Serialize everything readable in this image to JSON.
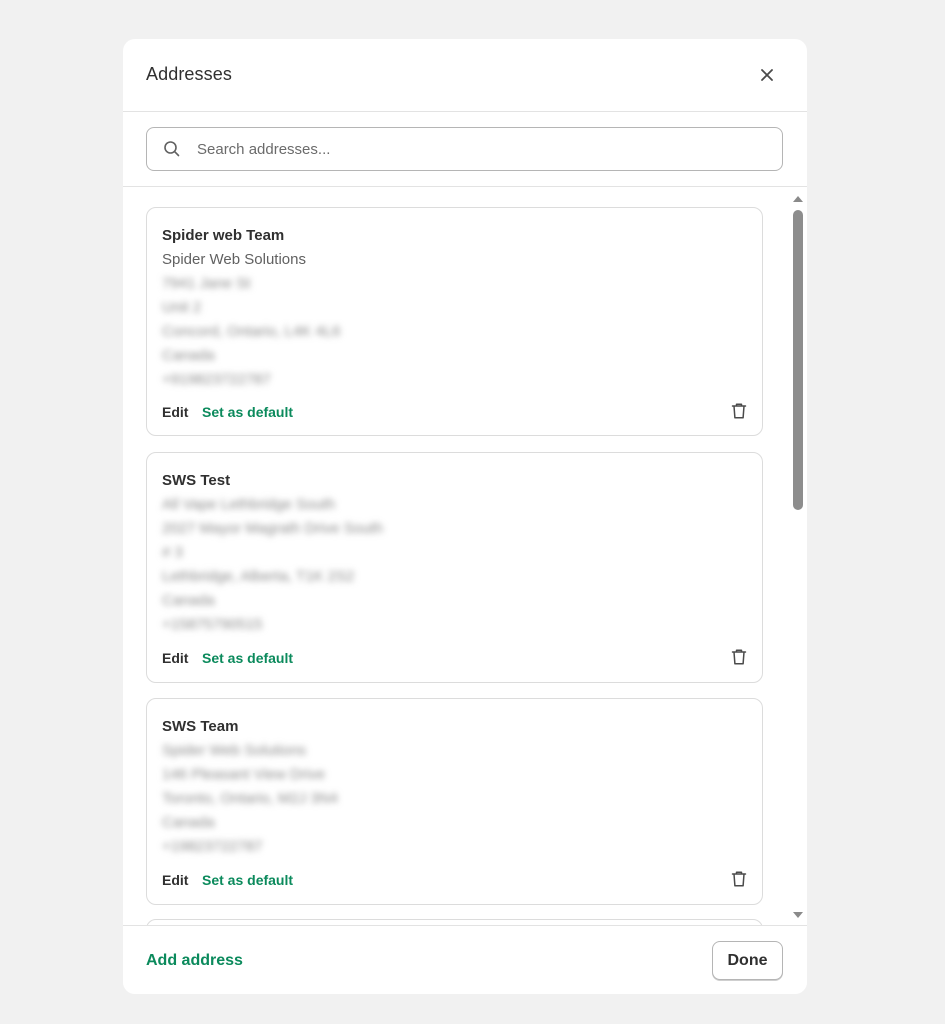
{
  "modal": {
    "title": "Addresses",
    "search": {
      "placeholder": "Search addresses..."
    },
    "addresses": [
      {
        "name": "Spider web Team",
        "company": "Spider Web Solutions",
        "lines": [
          "7941 Jane St",
          "Unit 2",
          "Concord, Ontario, L4K 4L6",
          "Canada",
          "+919823722787"
        ],
        "edit_label": "Edit",
        "default_label": "Set as default"
      },
      {
        "name": "SWS Test",
        "lines": [
          "All Vape Lethbridge South",
          "2027 Mayor Magrath Drive South",
          "# 3",
          "Lethbridge, Alberta, T1K 2S2",
          "Canada",
          "+15875790515"
        ],
        "edit_label": "Edit",
        "default_label": "Set as default"
      },
      {
        "name": "SWS Team",
        "lines": [
          "Spider Web Solutions",
          "146 Pleasant View Drive",
          "Toronto, Ontario, M2J 3N4",
          "Canada",
          "+19823722787"
        ],
        "edit_label": "Edit",
        "default_label": "Set as default"
      }
    ],
    "footer": {
      "add_label": "Add address",
      "done_label": "Done"
    },
    "colors": {
      "accent": "#0b8a5c",
      "text": "#303030",
      "muted": "#616161"
    }
  }
}
